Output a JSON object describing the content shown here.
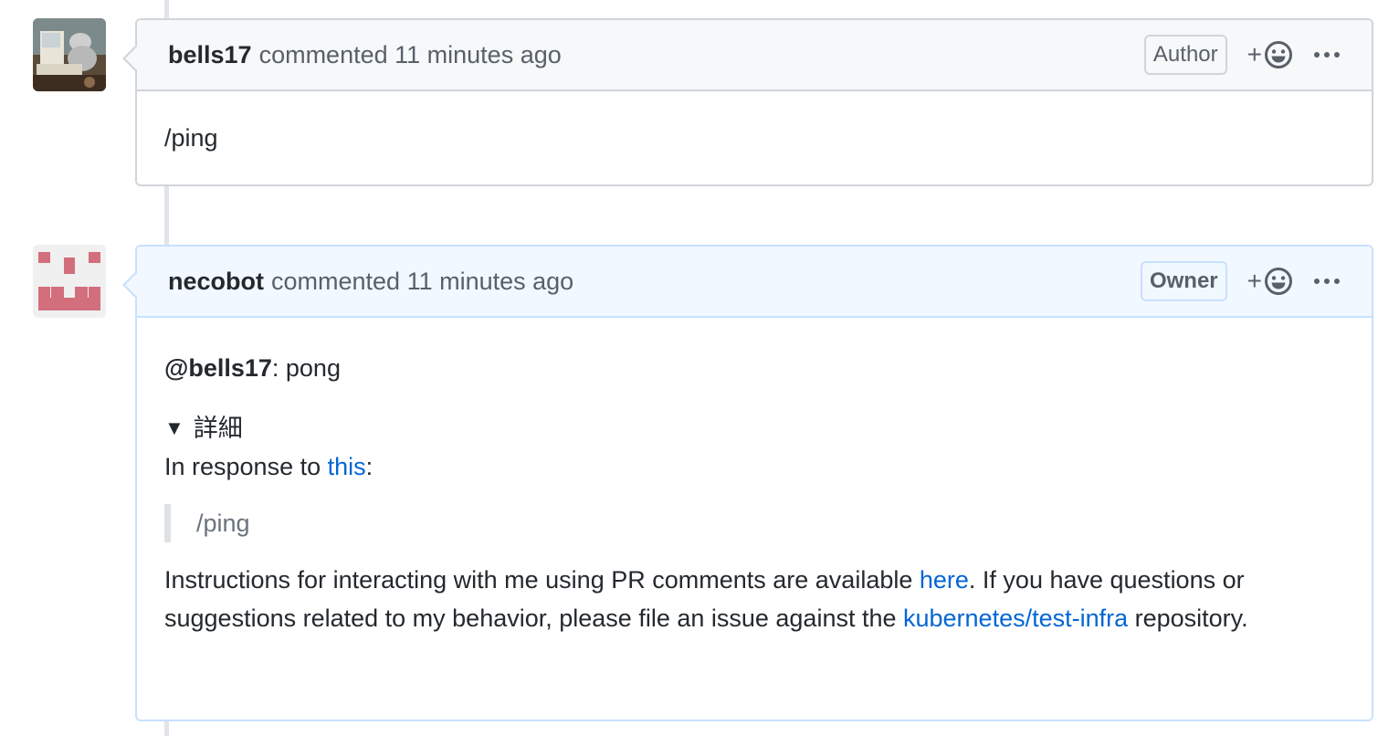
{
  "comments": [
    {
      "author": "bells17",
      "meta": "commented 11 minutes ago",
      "role": "Author",
      "reaction_plus": "+",
      "body": "/ping"
    },
    {
      "author": "necobot",
      "meta": "commented 11 minutes ago",
      "role": "Owner",
      "reaction_plus": "+",
      "mention": "@bells17",
      "reply": ": pong",
      "details_label": "詳細",
      "details_marker": "▼",
      "response_prefix": "In response to ",
      "response_link": "this",
      "response_suffix": ":",
      "quote": "/ping",
      "instructions_1": "Instructions for interacting with me using PR comments are available ",
      "instructions_link_1": "here",
      "instructions_2": ". If you have questions or suggestions related to my behavior, please file an issue against the ",
      "instructions_link_2": "kubernetes/test-infra",
      "instructions_3": " repository."
    }
  ],
  "icons": {
    "reaction": "smiley-icon",
    "more": "kebab-horizontal-icon",
    "avatar_bot": "identicon"
  },
  "colors": {
    "link": "#0366d6",
    "bot_header_bg": "#f1f8ff",
    "identicon": "#d36e7c"
  }
}
